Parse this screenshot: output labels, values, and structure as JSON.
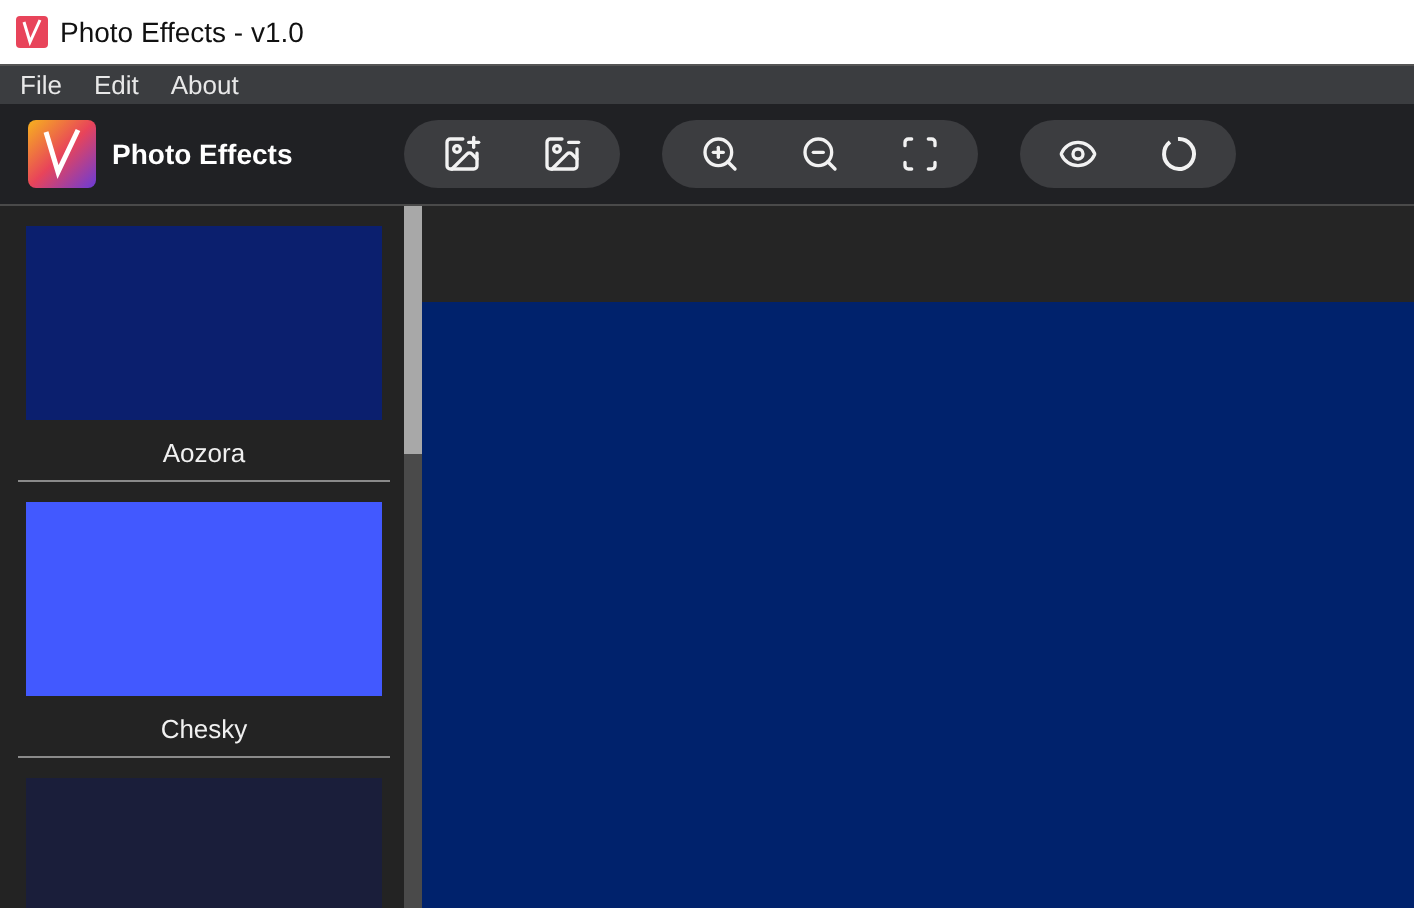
{
  "window": {
    "title": "Photo Effects - v1.0"
  },
  "menu": [
    "File",
    "Edit",
    "About"
  ],
  "app": {
    "name": "Photo Effects"
  },
  "toolbar": [
    {
      "kind": "add-image"
    },
    {
      "kind": "remove-image"
    },
    {
      "kind": "zoom-in"
    },
    {
      "kind": "zoom-out"
    },
    {
      "kind": "fit"
    },
    {
      "kind": "preview"
    },
    {
      "kind": "reset"
    }
  ],
  "filters": [
    {
      "name": "Aozora",
      "color": "#0b1f6e"
    },
    {
      "name": "Chesky",
      "color": "#4259ff"
    },
    {
      "color": "#1a1e3a"
    }
  ],
  "canvas": {
    "color": "#00226c"
  }
}
